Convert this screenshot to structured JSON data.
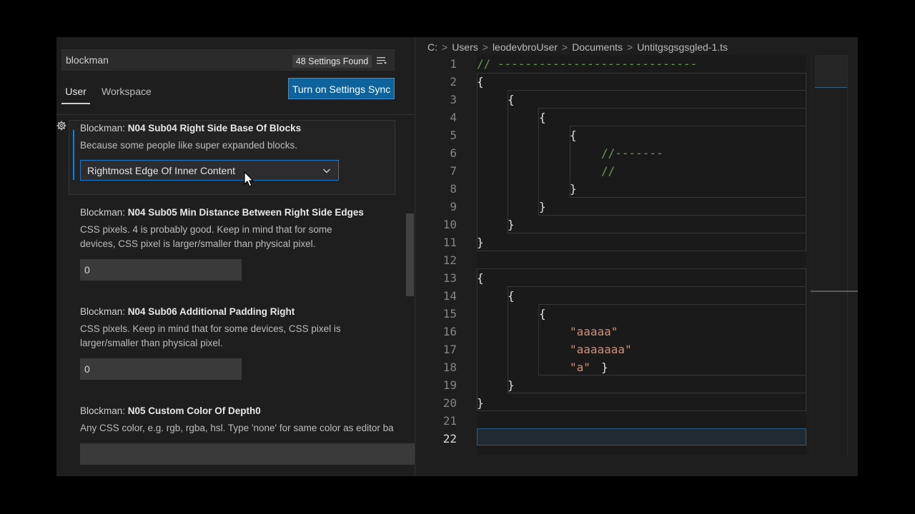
{
  "settings": {
    "search_value": "blockman",
    "results_count": "48 Settings Found",
    "tabs": {
      "user": "User",
      "workspace": "Workspace"
    },
    "sync_button": "Turn on Settings Sync",
    "items": [
      {
        "prefix": "Blockman: ",
        "title": "N04 Sub04 Right Side Base Of Blocks",
        "desc": [
          "Because some people like super expanded blocks."
        ],
        "value": "Rightmost Edge Of Inner Content"
      },
      {
        "prefix": "Blockman: ",
        "title": "N04 Sub05 Min Distance Between Right Side Edges",
        "desc": [
          "CSS pixels. 4 is probably good. Keep in mind that for some",
          "devices, CSS pixel is larger/smaller than physical pixel."
        ],
        "value": "0"
      },
      {
        "prefix": "Blockman: ",
        "title": "N04 Sub06 Additional Padding Right",
        "desc": [
          "CSS pixels. Keep in mind that for some devices, CSS pixel is",
          "larger/smaller than physical pixel."
        ],
        "value": "0"
      },
      {
        "prefix": "Blockman: ",
        "title": "N05 Custom Color Of Depth0",
        "desc": [
          "Any CSS color, e.g. rgb, rgba, hsl. Type 'none' for same color as editor ba"
        ],
        "value": ""
      }
    ]
  },
  "editor": {
    "breadcrumb": [
      "C:",
      "Users",
      "leodevbroUser",
      "Documents",
      "Untitgsgsgsgled-1.ts"
    ],
    "line_numbers": [
      "1",
      "2",
      "3",
      "4",
      "5",
      "6",
      "7",
      "8",
      "9",
      "10",
      "11",
      "12",
      "13",
      "14",
      "15",
      "16",
      "17",
      "18",
      "19",
      "20",
      "21",
      "22"
    ],
    "active_line": "22",
    "code": {
      "l1": "// -----------------------------",
      "open": "{",
      "close": "}",
      "l6": "//-------",
      "l7": "//",
      "l16": "\"aaaaa\"",
      "l17": "\"aaaaaaa\"",
      "l18": "\"a\"",
      "l18_close": "}"
    }
  },
  "colors": {
    "accent": "#0e639c",
    "focus_border": "#1b78c8",
    "comment": "#6a9955",
    "string": "#ce9178"
  },
  "icons": {
    "filter": "filter-list-icon",
    "gear": "gear-icon",
    "chevron": "chevron-down-icon",
    "cursor": "mouse-pointer-icon"
  }
}
